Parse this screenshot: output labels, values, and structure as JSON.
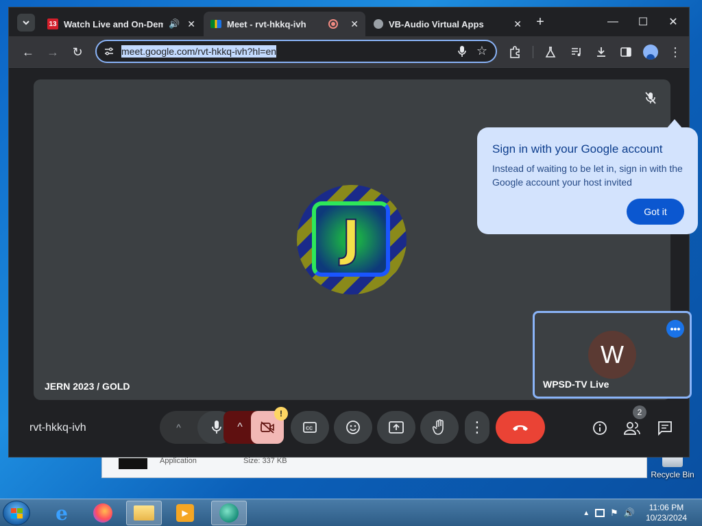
{
  "browser": {
    "tabs": [
      {
        "title": "Watch Live and On-Deman",
        "favicon": "channel-13-icon",
        "audio": true
      },
      {
        "title": "Meet - rvt-hkkq-ivh",
        "favicon": "google-meet-icon",
        "recording": true
      },
      {
        "title": "VB-Audio Virtual Apps",
        "favicon": "globe-icon"
      }
    ],
    "url": "meet.google.com/rvt-hkkq-ivh?hl=en"
  },
  "meet": {
    "main_participant_name": "JERN 2023 / GOLD",
    "main_avatar_letter": "J",
    "popup": {
      "title": "Sign in with your Google account",
      "body": "Instead of waiting to be let in, sign in with the Google account your host invited",
      "button": "Got it"
    },
    "self_tile": {
      "initial": "W",
      "name": "WPSD-TV Live"
    },
    "meeting_code": "rvt-hkkq-ivh",
    "participant_count": "2",
    "camera_warning": "!"
  },
  "desktop": {
    "bg_window": {
      "type_label": "Application",
      "size_label": "Size: 337 KB"
    },
    "recycle_bin_label": "Recycle Bin"
  },
  "taskbar": {
    "time": "11:06 PM",
    "date": "10/23/2024"
  },
  "colors": {
    "accent_blue": "#8ab4f8",
    "hangup_red": "#ea4335",
    "popup_bg": "#d3e3fd",
    "button_blue": "#0b57d0"
  }
}
